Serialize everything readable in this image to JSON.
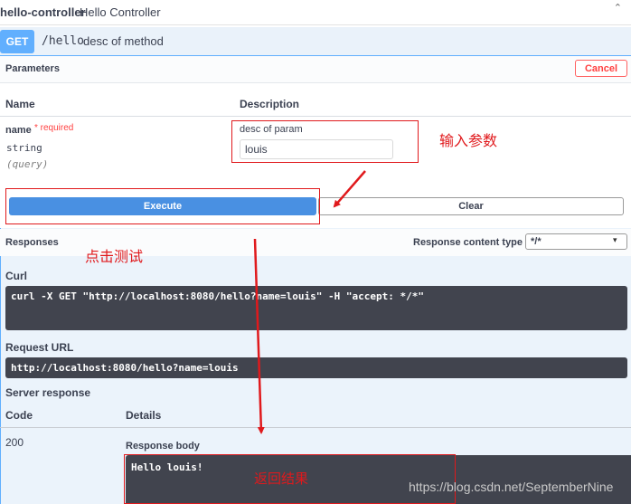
{
  "controller": {
    "name": "hello-controller",
    "description": "Hello Controller"
  },
  "operation": {
    "method": "GET",
    "path": "/hello",
    "description": "desc of method"
  },
  "parameters": {
    "title": "Parameters",
    "cancel_label": "Cancel",
    "col_name": "Name",
    "col_description": "Description",
    "items": [
      {
        "name": "name",
        "required": "* required",
        "type": "string",
        "in": "(query)",
        "description": "desc of param",
        "value": "louis"
      }
    ]
  },
  "actions": {
    "execute_label": "Execute",
    "clear_label": "Clear"
  },
  "responses": {
    "title": "Responses",
    "content_type_label": "Response content type",
    "content_type_value": "*/*"
  },
  "curl": {
    "title": "Curl",
    "command": "curl -X GET \"http://localhost:8080/hello?name=louis\" -H \"accept: */*\""
  },
  "request_url": {
    "title": "Request URL",
    "value": "http://localhost:8080/hello?name=louis"
  },
  "server_response": {
    "title": "Server response",
    "code_header": "Code",
    "details_header": "Details",
    "code": "200",
    "body_title": "Response body",
    "body": "Hello louis!"
  },
  "annotations": {
    "input_note": "输入参数",
    "click_note": "点击测试",
    "result_note": "返回结果"
  },
  "watermark": "https://blog.csdn.net/SeptemberNine",
  "colors": {
    "get_blue": "#61affe",
    "execute_blue": "#4990e2",
    "code_bg": "#41444e",
    "annotation_red": "#e0191c",
    "cancel_red": "#ff4040"
  }
}
